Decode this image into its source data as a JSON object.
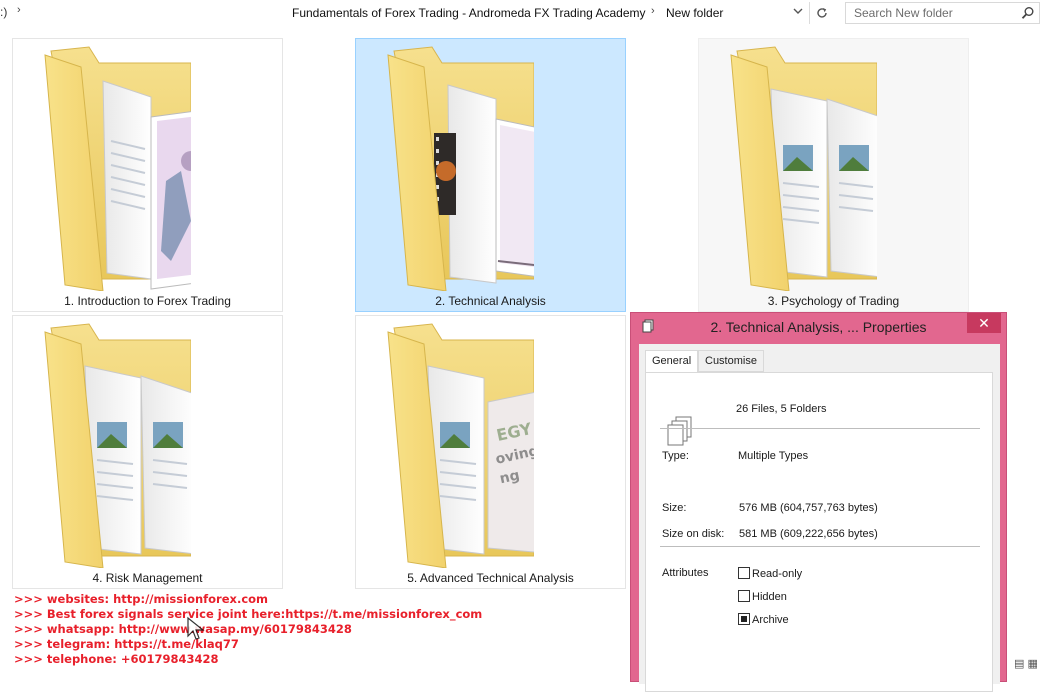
{
  "address_bar": {
    "left_fragment": ":)",
    "crumb_sep": "›",
    "crumbs": [
      "Fundamentals of Forex Trading - Andromeda FX Trading Academy",
      "New folder"
    ],
    "dropdown_icon": "chevron-down-icon",
    "refresh_icon": "refresh-icon",
    "search_placeholder": "Search New folder",
    "search_icon": "search-icon"
  },
  "folders": [
    {
      "label": "1. Introduction to Forex Trading",
      "selected": false
    },
    {
      "label": "2. Technical Analysis",
      "selected": true
    },
    {
      "label": "3. Psychology of Trading",
      "selected": false
    },
    {
      "label": "4. Risk Management",
      "selected": false
    },
    {
      "label": "5. Advanced Technical Analysis",
      "selected": false
    }
  ],
  "folder_thumb_text": [
    "EGY",
    "oving",
    "ng"
  ],
  "promo_lines": [
    ">>> websites: http://missionforex.com",
    ">>> Best forex signals service joint here:https://t.me/missionforex_com",
    ">>> whatsapp: http://www.wasap.my/60179843428",
    ">>> telegram: https://t.me/klaq77",
    ">>> telephone: +60179843428"
  ],
  "properties_dialog": {
    "title": "2. Technical Analysis, ... Properties",
    "close_label": "✕",
    "tabs": [
      "General",
      "Customise"
    ],
    "active_tab": "General",
    "summary": "26 Files, 5 Folders",
    "type_label": "Type:",
    "type_value": "Multiple Types",
    "size_label": "Size:",
    "size_value": "576 MB (604,757,763 bytes)",
    "size_on_disk_label": "Size on disk:",
    "size_on_disk_value": "581 MB (609,222,656 bytes)",
    "attributes_label": "Attributes",
    "attributes": [
      {
        "label": "Read-only",
        "checked": false
      },
      {
        "label": "Hidden",
        "checked": false
      },
      {
        "label": "Archive",
        "checked": true
      }
    ]
  },
  "view_icons": "▤ ▦",
  "colors": {
    "selection": "#cce8ff",
    "dialog_frame": "#e2678f",
    "close_button": "#c7395f",
    "promo_text": "#e8202b",
    "folder_yellow": "#f5d86e"
  }
}
